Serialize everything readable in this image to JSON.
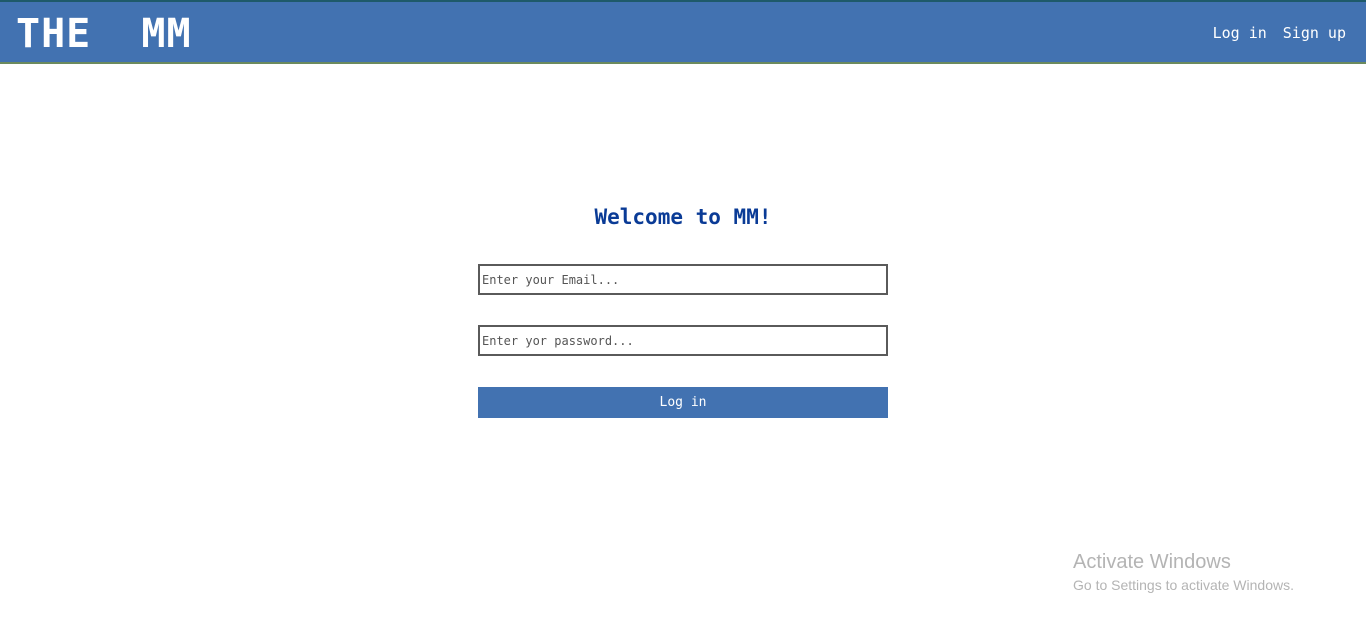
{
  "header": {
    "logo": "THE  MM",
    "nav": {
      "login_label": "Log in",
      "signup_label": "Sign up"
    }
  },
  "main": {
    "title": "Welcome to MM!",
    "email_placeholder": "Enter your Email...",
    "password_placeholder": "Enter yor password...",
    "login_button_label": "Log in"
  },
  "os_watermark": {
    "line1": "Activate Windows",
    "line2": "Go to Settings to activate Windows."
  },
  "colors": {
    "header_bg": "#4272b1",
    "title_color": "#0a3b96",
    "button_bg": "#4272b1"
  }
}
